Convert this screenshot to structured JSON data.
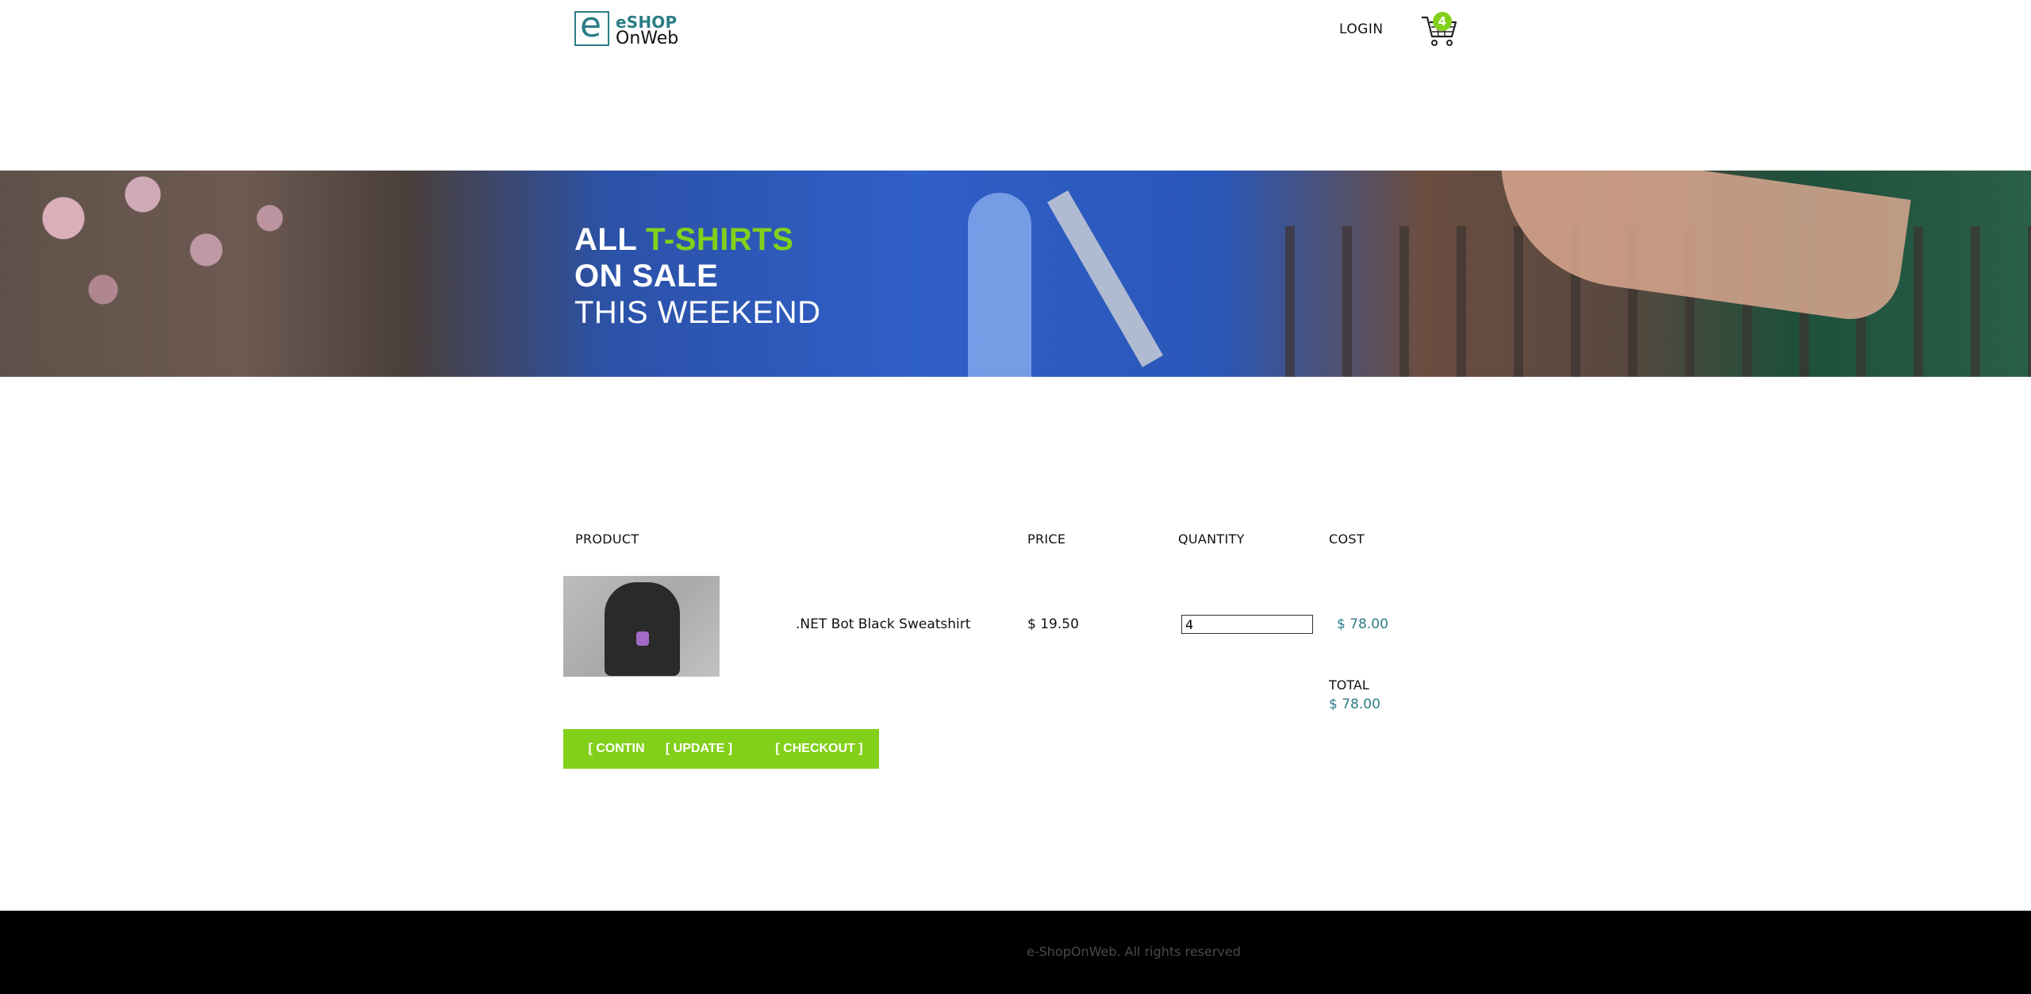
{
  "header": {
    "logo_line1": "eSHOP",
    "logo_line2": "OnWeb",
    "login_label": "LOGIN",
    "cart_count": "4"
  },
  "hero": {
    "line1_a": "ALL",
    "line1_b": "T-SHIRTS",
    "line2": "ON SALE",
    "line3": "THIS WEEKEND"
  },
  "cart": {
    "columns": [
      "PRODUCT",
      "PRICE",
      "QUANTITY",
      "COST"
    ],
    "items": [
      {
        "name": ".NET Bot Black Sweatshirt",
        "price": "$ 19.50",
        "quantity": "4",
        "cost": "$ 78.00"
      }
    ],
    "total_label": "TOTAL",
    "total_value": "$ 78.00",
    "buttons": {
      "continue": "[ CONTIN",
      "update": "[ UPDATE ]",
      "checkout": "[ CHECKOUT ]"
    }
  },
  "footer": {
    "text": "e-ShopOnWeb. All rights reserved"
  },
  "colors": {
    "accent_green": "#83d01b",
    "teal": "#2b7d86",
    "footer_bg": "#000000"
  }
}
